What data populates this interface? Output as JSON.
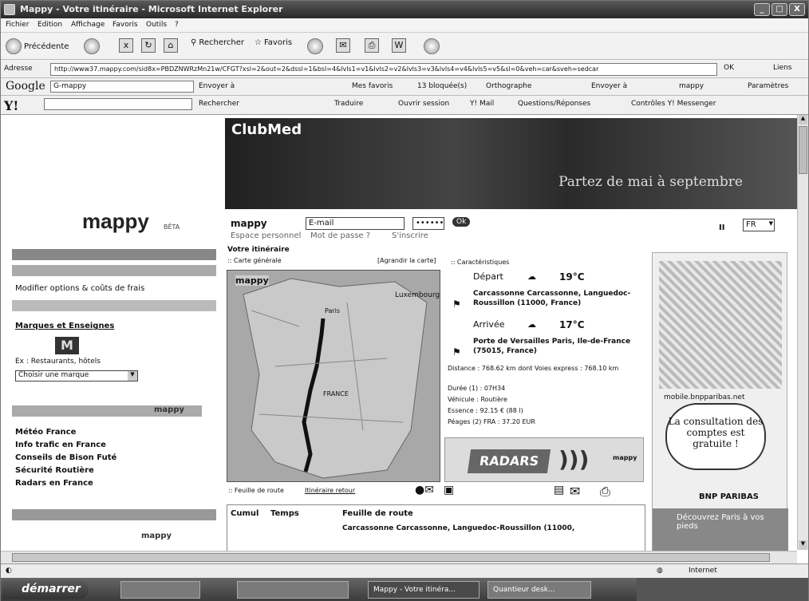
{
  "window": {
    "title": "Mappy - Votre itinéraire - Microsoft Internet Explorer",
    "controls": [
      "_",
      "□",
      "X"
    ]
  },
  "menu": [
    "Fichier",
    "Edition",
    "Affichage",
    "Favoris",
    "Outils",
    "?"
  ],
  "toolbar": {
    "back": "Précédente",
    "search": "Rechercher",
    "favorites": "Favoris"
  },
  "address": {
    "label": "Adresse",
    "url": "http://www37.mappy.com/sid8x=PBDZNWRzMn21w/CFGT?xsl=2&out=2&dssl=1&bsl=4&lvls1=v1&lvls2=v2&lvls3=v3&lvls4=v4&lvls5=v5&sl=0&veh=car&sveh=sedcar",
    "go": "OK",
    "links": "Liens"
  },
  "google_bar": {
    "logo": "Google",
    "query": "G-mappy",
    "items": [
      "Envoyer à",
      "Mes favoris",
      "13 bloquée(s)",
      "Orthographe",
      "Envoyer à",
      "mappy",
      "Paramètres"
    ]
  },
  "yahoo_bar": {
    "logo": "Y!",
    "search": "Rechercher",
    "items": [
      "Traduire",
      "Ouvrir session",
      "Y! Mail",
      "Questions/Réponses",
      "Contrôles Y! Messenger"
    ]
  },
  "banner": {
    "brand": "ClubMed",
    "slogan": "Partez de mai à septembre"
  },
  "site": {
    "logo": "mappy",
    "beta": "BÊTA",
    "mappy_mail": "mappy",
    "email_placeholder": "E-mail",
    "password": "••••••",
    "ok": "Ok",
    "espace": "Espace personnel",
    "forgot": "Mot de passe ?",
    "signup": "S'inscrire",
    "lang": "FR"
  },
  "left_nav": {
    "modify": "Modifier options & coûts de frais",
    "brands_title": "Marques et Enseignes",
    "brand_logo": "M",
    "example": "Ex : Restaurants, hôtels",
    "brand_select": "Choisir une marque",
    "mappy_small": "mappy",
    "links": [
      "Météo France",
      "Info trafic en France",
      "Conseils de Bison Futé",
      "Sécurité Routière",
      "Radars en France"
    ]
  },
  "itinerary": {
    "title": "Votre itinéraire",
    "overview": ":: Carte générale",
    "enlarge": "[Agrandir la carte]",
    "map_labels": [
      "mappy",
      "Luxembourg",
      "Paris",
      "FRANCE"
    ],
    "characteristics": ":: Caractéristiques",
    "depart_label": "Départ",
    "depart_temp": "19°C",
    "depart_place": "Carcassonne Carcassonne, Languedoc-Roussillon (11000, France)",
    "arrival_label": "Arrivée",
    "arrival_temp": "17°C",
    "arrival_place": "Porte de Versailles Paris, Ile-de-France (75015, France)",
    "distance": "Distance : 768.62 km dont Voies express : 768.10 km",
    "duration": "Durée (1) : 07H34",
    "vehicle": "Véhicule : Routière",
    "fuel": "Essence : 92.15 € (88 l)",
    "tolls": "Péages (2) FRA : 37.20 EUR",
    "radars": "RADARS",
    "radars_brand": "mappy"
  },
  "right_ad": {
    "url": "mobile.bnpparibas.net",
    "bubble": "La consultation des comptes est gratuite !",
    "bank": "BNP PARIBAS",
    "discover": "Découvrez Paris à vos pieds"
  },
  "roadmap": {
    "label": ":: Feuille de route",
    "return": "Itinéraire retour",
    "col_cumul": "Cumul",
    "col_time": "Temps",
    "col_sheet": "Feuille de route",
    "first_row": "Carcassonne Carcassonne, Languedoc-Roussillon (11000,"
  },
  "status": {
    "zone": "Internet"
  },
  "taskbar": {
    "start": "démarrer",
    "items": [
      "Mappy - Votre itinéra...",
      "Quantieur desk..."
    ]
  }
}
